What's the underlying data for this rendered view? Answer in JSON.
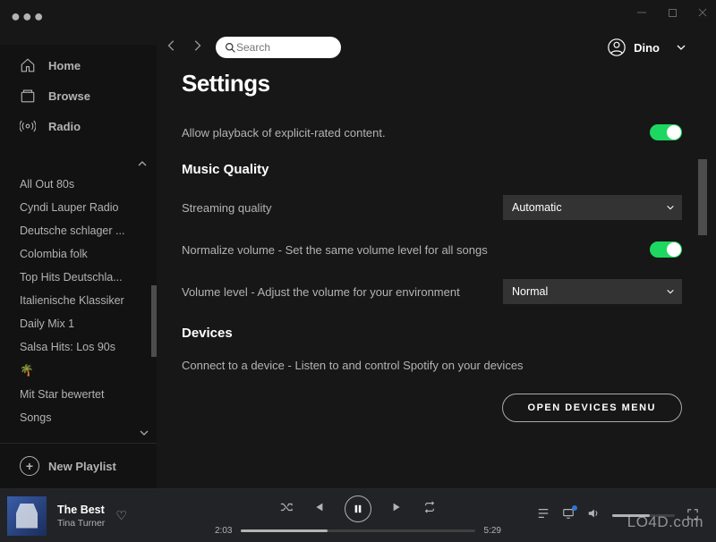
{
  "window": {
    "menu_dots": "●●●"
  },
  "topbar": {
    "search_placeholder": "Search",
    "user_name": "Dino"
  },
  "sidebar": {
    "nav": [
      {
        "label": "Home",
        "icon": "home"
      },
      {
        "label": "Browse",
        "icon": "browse"
      },
      {
        "label": "Radio",
        "icon": "radio"
      }
    ],
    "playlists": [
      "All Out 80s",
      "Cyndi Lauper Radio",
      "Deutsche schlager ...",
      "Colombia folk",
      "Top Hits Deutschla...",
      "Italienische Klassiker",
      "Daily Mix 1",
      "Salsa Hits: Los 90s",
      "🌴",
      "Mit Star bewertet",
      "Songs"
    ],
    "new_playlist": "New Playlist"
  },
  "settings": {
    "title": "Settings",
    "explicit_label": "Allow playback of explicit-rated content.",
    "explicit_on": true,
    "section_quality": "Music Quality",
    "streaming_label": "Streaming quality",
    "streaming_value": "Automatic",
    "normalize_label": "Normalize volume - Set the same volume level for all songs",
    "normalize_on": true,
    "volume_level_label": "Volume level - Adjust the volume for your environment",
    "volume_level_value": "Normal",
    "section_devices": "Devices",
    "devices_label": "Connect to a device - Listen to and control Spotify on your devices",
    "devices_button": "OPEN DEVICES MENU"
  },
  "player": {
    "track_title": "The Best",
    "track_artist": "Tina Turner",
    "elapsed": "2:03",
    "total": "5:29",
    "progress_pct": 37
  },
  "watermark": "LO4D.com"
}
